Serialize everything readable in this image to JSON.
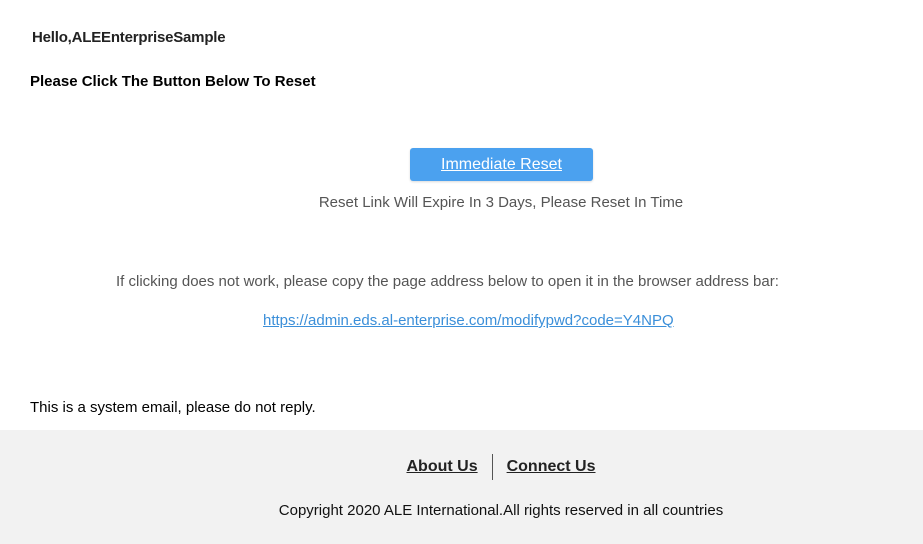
{
  "email": {
    "greeting": "Hello,ALEEnterpriseSample",
    "instruction": "Please Click The Button Below To Reset",
    "reset_button_label": "Immediate Reset",
    "expire_note": "Reset Link Will Expire In 3 Days, Please Reset In Time",
    "copy_hint": "If clicking does not work, please copy the page address below to open it in the browser address bar:",
    "reset_link": "https://admin.eds.al-enterprise.com/modifypwd?code=Y4NPQ",
    "system_note": "This is a system email, please do not reply."
  },
  "footer": {
    "links": [
      {
        "label": "About Us"
      },
      {
        "label": "Connect Us"
      }
    ],
    "copyright": "Copyright 2020 ALE International.All rights reserved in all countries"
  },
  "colors": {
    "button": "#4ba1ef",
    "link": "#3b8fd9",
    "footer_bg": "#f2f2f2"
  }
}
